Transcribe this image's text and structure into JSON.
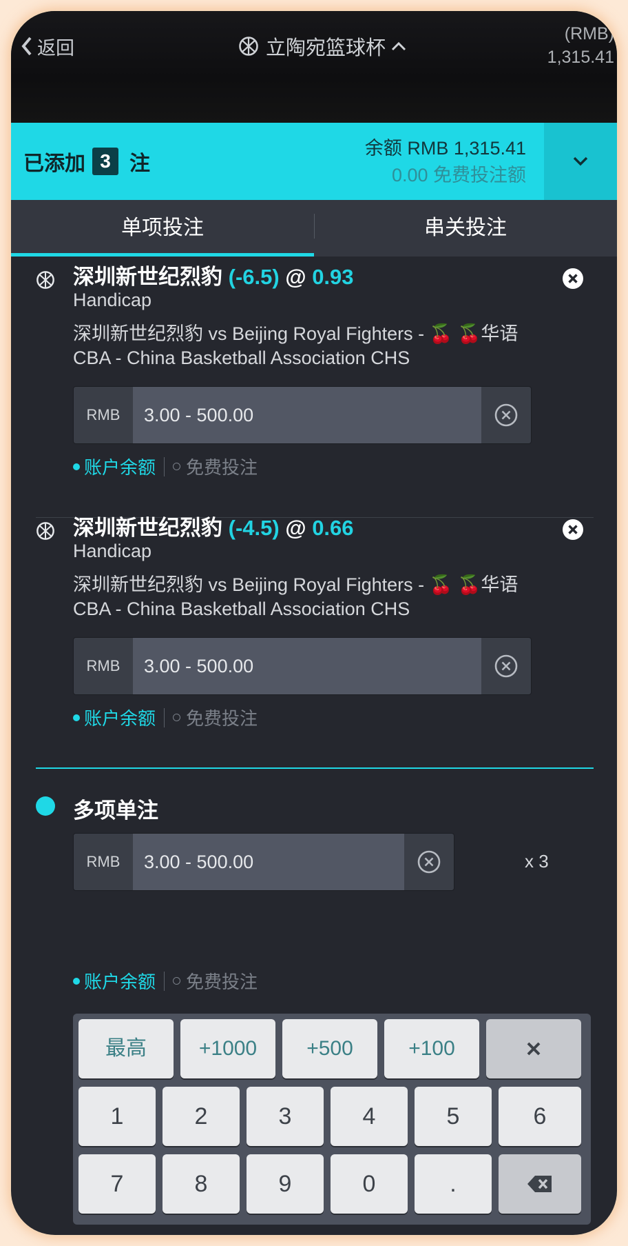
{
  "header": {
    "back_label": "返回",
    "title": "立陶宛篮球杯",
    "balance_currency": "(RMB)",
    "balance_amount": "1,315.41"
  },
  "betslip": {
    "added_prefix": "已添加",
    "count": "3",
    "added_suffix": "注",
    "balance_line": "余额 RMB 1,315.41",
    "free_line": "0.00 免费投注额"
  },
  "tabs": [
    "单项投注",
    "串关投注"
  ],
  "bets": [
    {
      "team": "深圳新世纪烈豹",
      "line": "(-6.5)",
      "at": "@",
      "odds": "0.93",
      "market": "Handicap",
      "match": "深圳新世纪烈豹 vs Beijing Royal Fighters - 🍒 🍒华语",
      "league": "CBA - China Basketball Association CHS",
      "currency": "RMB",
      "stake_placeholder": "3.00 - 500.00",
      "opt_balance": "账户余额",
      "opt_free": "免费投注"
    },
    {
      "team": "深圳新世纪烈豹",
      "line": "(-4.5)",
      "at": "@",
      "odds": "0.66",
      "market": "Handicap",
      "match": "深圳新世纪烈豹 vs Beijing Royal Fighters - 🍒 🍒华语",
      "league": "CBA - China Basketball Association CHS",
      "currency": "RMB",
      "stake_placeholder": "3.00 - 500.00",
      "opt_balance": "账户余额",
      "opt_free": "免费投注"
    }
  ],
  "multi": {
    "title": "多项单注",
    "currency": "RMB",
    "stake_placeholder": "3.00 - 500.00",
    "multiplier": "x 3",
    "opt_balance": "账户余额",
    "opt_free": "免费投注"
  },
  "keypad": {
    "quick": [
      "最高",
      "+1000",
      "+500",
      "+100"
    ],
    "row1": [
      "1",
      "2",
      "3",
      "4",
      "5",
      "6"
    ],
    "row2": [
      "7",
      "8",
      "9",
      "0",
      "."
    ]
  },
  "icons": {
    "back": "chevron-left-icon",
    "sport": "basketball-icon",
    "remove": "close-circle-icon",
    "clear": "clear-circle-icon",
    "collapse": "chevron-down-icon",
    "keypad_close": "close-icon",
    "backspace": "backspace-icon"
  },
  "colors": {
    "accent": "#1fd8e6",
    "background": "#25272e",
    "input": "#525764"
  }
}
